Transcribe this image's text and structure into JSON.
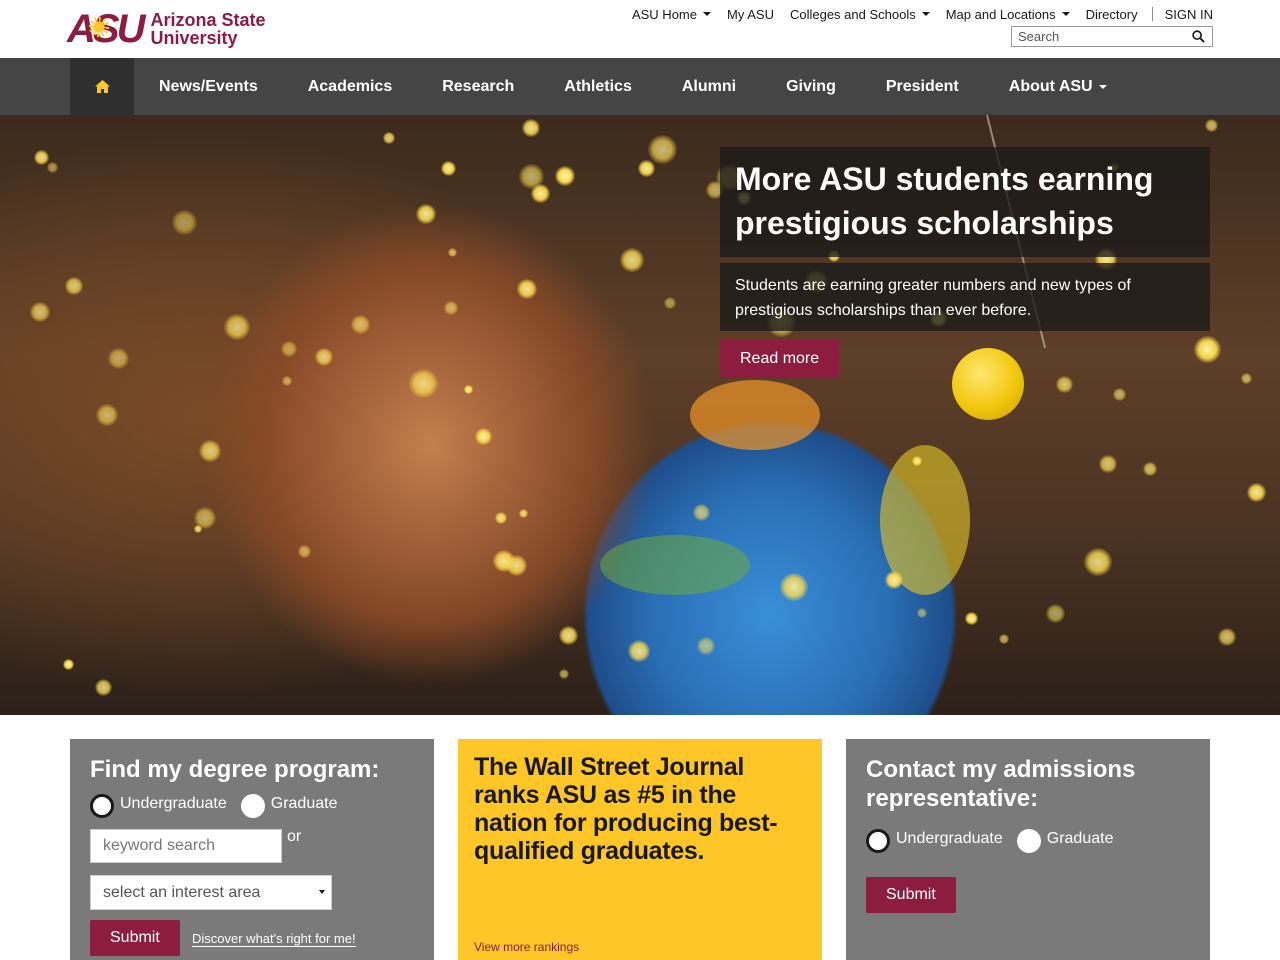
{
  "logo": {
    "mark": "ASU",
    "line1": "Arizona State",
    "line2": "University"
  },
  "topnav": {
    "items": [
      "ASU Home",
      "My ASU",
      "Colleges and Schools",
      "Map and Locations",
      "Directory"
    ],
    "sign_in": "SIGN IN",
    "search_placeholder": "Search"
  },
  "mainnav": {
    "home_icon": "home-icon",
    "items": [
      "News/Events",
      "Academics",
      "Research",
      "Athletics",
      "Alumni",
      "Giving",
      "President",
      "About ASU"
    ]
  },
  "hero": {
    "title": "More ASU students earning prestigious scholarships",
    "body": "Students are earning greater numbers and new types of prestigious scholarships than ever before.",
    "cta": "Read more"
  },
  "degree_card": {
    "title": "Find my degree program:",
    "radio_undergrad": "Undergraduate",
    "radio_grad": "Graduate",
    "keyword_placeholder": "keyword search",
    "or": "or",
    "select_value": "select an interest area",
    "submit": "Submit",
    "discover": "Discover what's right for me!"
  },
  "ranking_card": {
    "title": "The Wall Street Journal ranks ASU as #5 in the nation for producing best-qualified graduates.",
    "link": "View more rankings"
  },
  "contact_card": {
    "title": "Contact my admissions representative:",
    "radio_undergrad": "Undergraduate",
    "radio_grad": "Graduate",
    "submit": "Submit"
  },
  "colors": {
    "maroon": "#8c1d40",
    "gold": "#ffc627",
    "nav": "#454545",
    "card_gray": "#7a7a7a"
  }
}
